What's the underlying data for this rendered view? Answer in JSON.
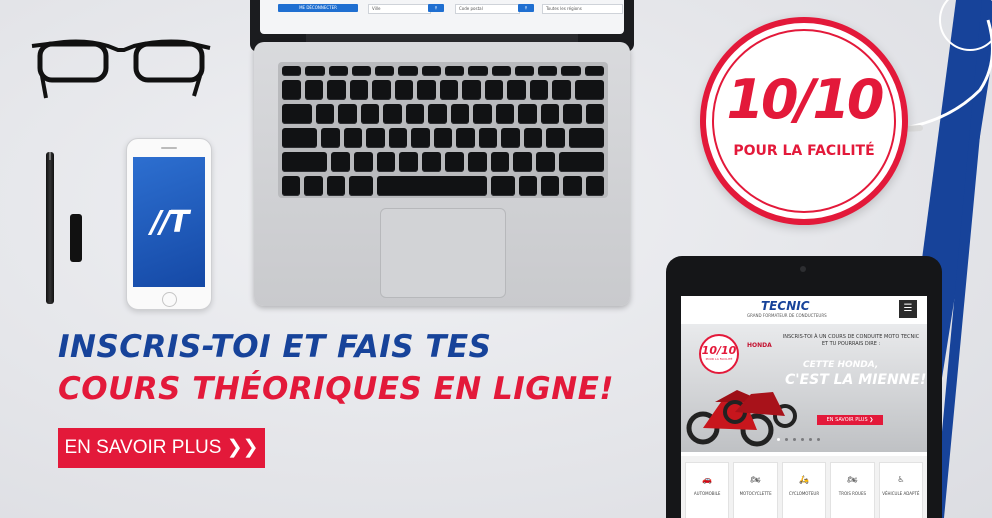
{
  "laptop": {
    "screen_button": "ME DÉCONNECTER",
    "screen_field_1": "Ville",
    "screen_field_2": "Code postal",
    "screen_select": "Toutes les régions"
  },
  "phone": {
    "logo": "//T"
  },
  "badge": {
    "score": "10/10",
    "caption": "POUR LA FACILITÉ"
  },
  "headline": {
    "line1": "INSCRIS-TOI ET FAIS TES",
    "line2": "COURS THÉORIQUES EN LIGNE!"
  },
  "cta": {
    "label": "EN SAVOIR PLUS ❯❯"
  },
  "tablet": {
    "logo": "TECNIC",
    "tagline": "GRAND FORMATEUR DE CONDUCTEURS",
    "menu_icon": "☰",
    "hero": {
      "badge_score": "10/10",
      "badge_caption": "POUR LA FACILITÉ",
      "brand": "HONDA",
      "message": "INSCRIS-TOI À UN COURS DE CONDUITE MOTO TECNIC ET TU POURRAIS DIRE :",
      "slogan_line1": "CETTE HONDA,",
      "slogan_line2": "C'EST LA MIENNE!",
      "more_button": "EN SAVOIR PLUS ❯"
    },
    "categories": [
      {
        "icon": "car-icon",
        "glyph": "🚗",
        "label": "AUTOMOBILE"
      },
      {
        "icon": "motorcycle-icon",
        "glyph": "🏍",
        "label": "MOTOCYCLETTE"
      },
      {
        "icon": "moped-icon",
        "glyph": "🛵",
        "label": "CYCLOMOTEUR"
      },
      {
        "icon": "three-wheeler-icon",
        "glyph": "🏍",
        "label": "TROIS ROUES"
      },
      {
        "icon": "accessible-vehicle-icon",
        "glyph": "♿",
        "label": "VÉHICULE ADAPTÉ"
      }
    ]
  },
  "colors": {
    "brand_red": "#e3193a",
    "brand_blue": "#17439a",
    "background": "#e6e7eb"
  }
}
